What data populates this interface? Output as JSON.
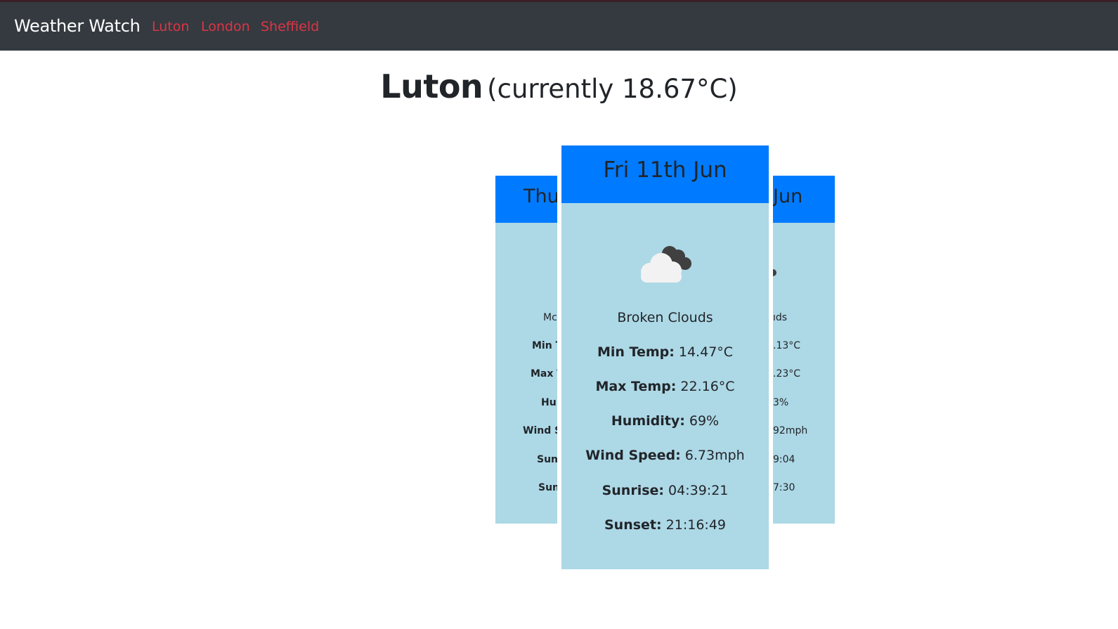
{
  "nav": {
    "brand": "Weather Watch",
    "links": [
      "Luton",
      "London",
      "Sheffield"
    ]
  },
  "page": {
    "city": "Luton",
    "current": "(currently 18.67°C)"
  },
  "cards": {
    "left": {
      "date": "Thu",
      "desc": "Mc",
      "rows": [
        "Min T",
        "Max T",
        "Hu",
        "Wind S",
        "Sun",
        "Sun"
      ]
    },
    "main": {
      "date": "Fri 11th Jun",
      "icon": "broken-clouds-icon",
      "desc": "Broken Clouds",
      "labels": [
        "Min Temp:",
        "Max Temp:",
        "Humidity:",
        "Wind Speed:",
        "Sunrise:",
        "Sunset:"
      ],
      "values": [
        " 14.47°C",
        " 22.16°C",
        " 69%",
        " 6.73mph",
        " 04:39:21",
        " 21:16:49"
      ]
    },
    "right": {
      "date": "Jun",
      "desc": "ıds",
      "rows": [
        ".13°C",
        ".23°C",
        "3%",
        "92mph",
        "9:04",
        "7:30"
      ]
    }
  },
  "colors": {
    "navbar": "#343a40",
    "link": "#dc3545",
    "card_header": "#007bff",
    "card_body": "#add8e6"
  }
}
